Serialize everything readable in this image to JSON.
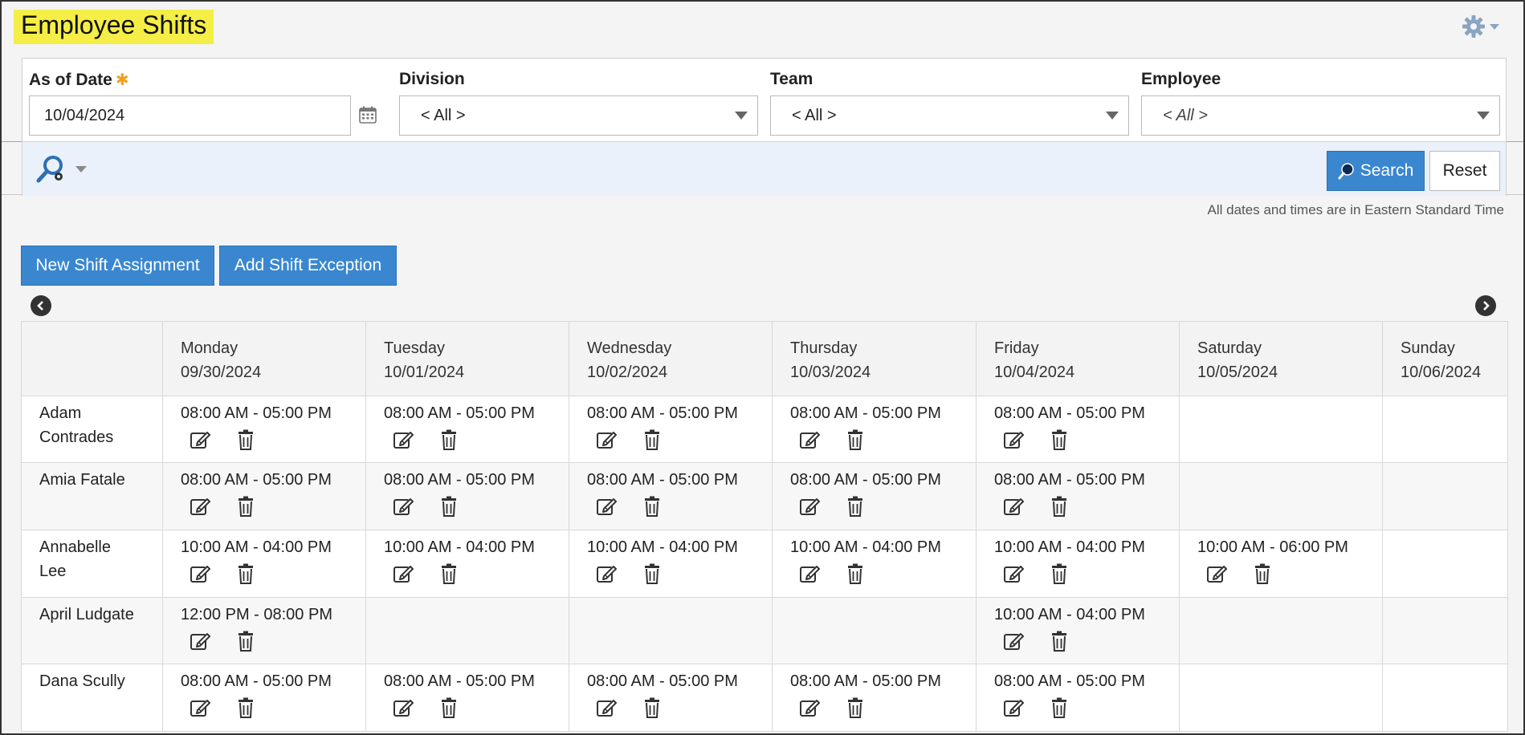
{
  "page": {
    "title": "Employee Shifts"
  },
  "filters": {
    "as_of_date": {
      "label": "As of Date",
      "required_mark": "✱",
      "value": "10/04/2024"
    },
    "division": {
      "label": "Division",
      "value": "< All >"
    },
    "team": {
      "label": "Team",
      "value": "< All >"
    },
    "employee": {
      "label": "Employee",
      "value": "< All >"
    }
  },
  "toolbar": {
    "search_label": "Search",
    "reset_label": "Reset"
  },
  "timezone_note": "All dates and times are in Eastern Standard Time",
  "actions": {
    "new_shift": "New Shift Assignment",
    "add_exception": "Add Shift Exception"
  },
  "grid": {
    "days": [
      {
        "day": "Monday",
        "date": "09/30/2024"
      },
      {
        "day": "Tuesday",
        "date": "10/01/2024"
      },
      {
        "day": "Wednesday",
        "date": "10/02/2024"
      },
      {
        "day": "Thursday",
        "date": "10/03/2024"
      },
      {
        "day": "Friday",
        "date": "10/04/2024"
      },
      {
        "day": "Saturday",
        "date": "10/05/2024"
      },
      {
        "day": "Sunday",
        "date": "10/06/2024"
      }
    ],
    "rows": [
      {
        "employee": "Adam Contrades",
        "shifts": [
          "08:00 AM - 05:00 PM",
          "08:00 AM - 05:00 PM",
          "08:00 AM - 05:00 PM",
          "08:00 AM - 05:00 PM",
          "08:00 AM - 05:00 PM",
          "",
          ""
        ]
      },
      {
        "employee": "Amia Fatale",
        "shifts": [
          "08:00 AM - 05:00 PM",
          "08:00 AM - 05:00 PM",
          "08:00 AM - 05:00 PM",
          "08:00 AM - 05:00 PM",
          "08:00 AM - 05:00 PM",
          "",
          ""
        ]
      },
      {
        "employee": "Annabelle Lee",
        "shifts": [
          "10:00 AM - 04:00 PM",
          "10:00 AM - 04:00 PM",
          "10:00 AM - 04:00 PM",
          "10:00 AM - 04:00 PM",
          "10:00 AM - 04:00 PM",
          "10:00 AM - 06:00 PM",
          ""
        ]
      },
      {
        "employee": "April Ludgate",
        "shifts": [
          "12:00 PM - 08:00 PM",
          "",
          "",
          "",
          "10:00 AM - 04:00 PM",
          "",
          ""
        ]
      },
      {
        "employee": "Dana Scully",
        "shifts": [
          "08:00 AM - 05:00 PM",
          "08:00 AM - 05:00 PM",
          "08:00 AM - 05:00 PM",
          "08:00 AM - 05:00 PM",
          "08:00 AM - 05:00 PM",
          "",
          ""
        ]
      }
    ]
  },
  "icons": {
    "settings": "gear-icon",
    "calendar": "calendar-icon",
    "search_tool": "search-settings-icon",
    "edit": "edit-icon",
    "delete": "trash-icon",
    "prev": "chevron-left-icon",
    "next": "chevron-right-icon"
  },
  "colors": {
    "title_highlight": "#f4ee46",
    "primary": "#3a87cf",
    "toolbar_bg": "#eaf1fa"
  }
}
